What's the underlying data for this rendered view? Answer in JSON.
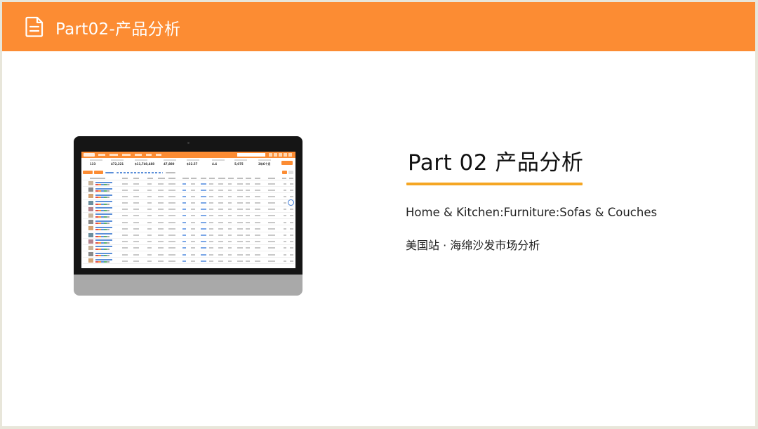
{
  "header": {
    "title": "Part02-产品分析",
    "icon": "document-icon",
    "background_color": "#fc8c33"
  },
  "main": {
    "part_title": "Part 02  产品分析",
    "underline_color": "#f5a623",
    "category": "Home & Kitchen:Furniture:Sofas & Couches",
    "market": "美国站 · 海绵沙发市场分析"
  },
  "screenshot_illustration": {
    "stats": [
      "133",
      "472,221",
      "$11,740,488",
      "47,880",
      "$32.57",
      "4.4",
      "5,075",
      "2年6个月"
    ]
  }
}
